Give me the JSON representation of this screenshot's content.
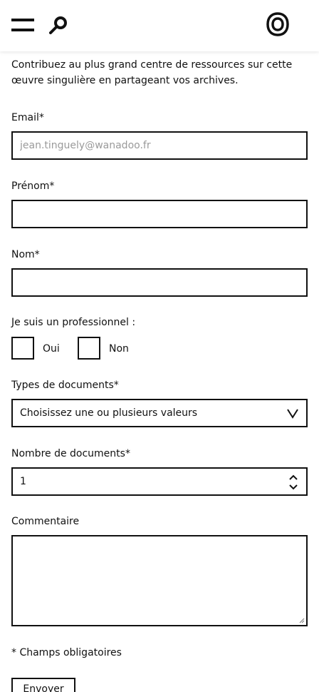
{
  "header": {
    "menu_icon": "hamburger-icon",
    "search_icon": "search-icon",
    "logo_icon": "logo-icon"
  },
  "intro": "Contribuez au plus grand centre de ressources sur cette œuvre singulière en partageant vos archives.",
  "form": {
    "email": {
      "label": "Email*",
      "placeholder": "jean.tinguely@wanadoo.fr",
      "value": ""
    },
    "firstname": {
      "label": "Prénom*",
      "value": ""
    },
    "lastname": {
      "label": "Nom*",
      "value": ""
    },
    "professional": {
      "label": "Je suis un professionnel :",
      "options": [
        {
          "label": "Oui",
          "checked": false
        },
        {
          "label": "Non",
          "checked": false
        }
      ]
    },
    "doc_types": {
      "label": "Types de documents*",
      "selected": "Choisissez une ou plusieurs valeurs"
    },
    "doc_count": {
      "label": "Nombre de documents*",
      "value": "1"
    },
    "comment": {
      "label": "Commentaire",
      "value": ""
    },
    "required_note": "* Champs obligatoires",
    "submit_label": "Envoyer"
  }
}
